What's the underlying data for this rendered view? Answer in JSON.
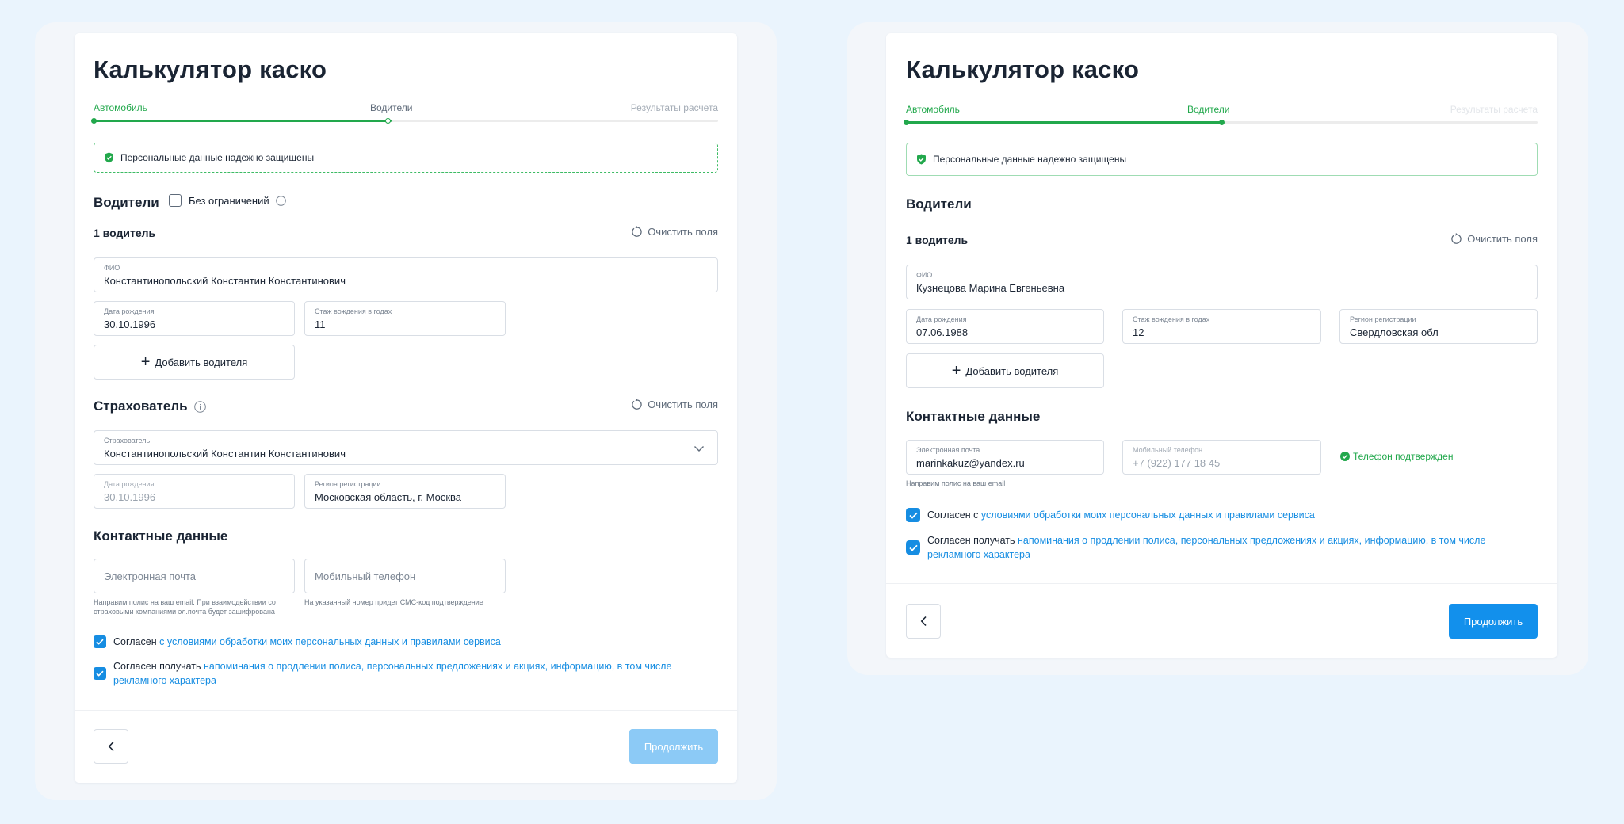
{
  "left": {
    "title": "Калькулятор каско",
    "steps": [
      "Автомобиль",
      "Водители",
      "Результаты расчета"
    ],
    "banner": "Персональные данные надежно защищены",
    "drivers": {
      "heading": "Водители",
      "no_limits_label": "Без ограничений",
      "driver_heading": "1 водитель",
      "clear_label": "Очистить поля",
      "fio_label": "ФИО",
      "fio_value": "Константинопольский Константин Константинович",
      "dob_label": "Дата рождения",
      "dob_value": "30.10.1996",
      "exp_label": "Стаж вождения в годах",
      "exp_value": "11",
      "add_driver": "Добавить водителя"
    },
    "insurer": {
      "heading": "Страхователь",
      "clear_label": "Очистить поля",
      "select_label": "Страхователь",
      "select_value": "Константинопольский Константин Константинович",
      "dob_label": "Дата рождения",
      "dob_value": "30.10.1996",
      "region_label": "Регион регистрации",
      "region_value": "Московская область, г. Москва"
    },
    "contacts": {
      "heading": "Контактные данные",
      "email_placeholder": "Электронная почта",
      "phone_placeholder": "Мобильный телефон",
      "email_hint": "Направим полис на ваш email. При взаимодействии со страховыми компаниями эл.почта будет зашифрована",
      "phone_hint": "На указанный номер придет СМС-код подтверждение"
    },
    "consent1_prefix": "Согласен",
    "consent1_link": "с условиями обработки моих персональных данных и правилами сервиса",
    "consent2_prefix": "Согласен получать",
    "consent2_link": "напоминания о продлении полиса, персональных предложениях и акциях, информацию, в том числе рекламного характера",
    "continue": "Продолжить"
  },
  "right": {
    "title": "Калькулятор каско",
    "steps": [
      "Автомобиль",
      "Водители",
      "Результаты расчета"
    ],
    "banner": "Персональные данные надежно защищены",
    "drivers": {
      "heading": "Водители",
      "driver_heading": "1 водитель",
      "clear_label": "Очистить поля",
      "fio_label": "ФИО",
      "fio_value": "Кузнецова Марина Евгеньевна",
      "dob_label": "Дата рождения",
      "dob_value": "07.06.1988",
      "exp_label": "Стаж вождения в годах",
      "exp_value": "12",
      "region_label": "Регион регистрации",
      "region_value": "Свердловская обл",
      "add_driver": "Добавить водителя"
    },
    "contacts": {
      "heading": "Контактные данные",
      "email_label": "Электронная почта",
      "email_value": "marinkakuz@yandex.ru",
      "phone_label": "Мобильный телефон",
      "phone_value": "+7 (922) 177 18 45",
      "verified": "Телефон подтвержден",
      "email_hint": "Направим полис на ваш email"
    },
    "consent1_prefix": "Согласен с",
    "consent1_link": "условиями обработки моих персональных данных и правилами сервиса",
    "consent2_prefix": "Согласен получать",
    "consent2_link": "напоминания о продлении полиса, персональных предложениях и акциях, информацию, в том числе рекламного характера",
    "continue": "Продолжить"
  },
  "colors": {
    "background": "#eaf4fd",
    "accent_green": "#22a84c",
    "link_blue": "#168de2",
    "primary_button": "#1290ec",
    "primary_button_disabled": "#8ccaf6"
  },
  "icons": [
    "shield-check-icon",
    "info-icon",
    "refresh-icon",
    "plus-icon",
    "chevron-down-icon",
    "chevron-left-icon",
    "check-icon",
    "check-circle-icon"
  ]
}
